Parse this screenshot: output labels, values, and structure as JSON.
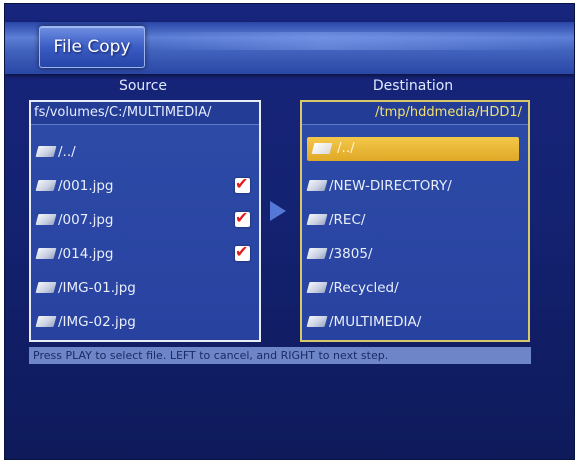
{
  "header": {
    "title": "File Copy"
  },
  "source": {
    "label": "Source",
    "path": "fs/volumes/C:/MULTIMEDIA/",
    "items": [
      {
        "name": "/../",
        "checked": false
      },
      {
        "name": "/001.jpg",
        "checked": true
      },
      {
        "name": "/007.jpg",
        "checked": true
      },
      {
        "name": "/014.jpg",
        "checked": true
      },
      {
        "name": "/IMG-01.jpg",
        "checked": false
      },
      {
        "name": "/IMG-02.jpg",
        "checked": false
      }
    ]
  },
  "destination": {
    "label": "Destination",
    "path": "/tmp/hddmedia/HDD1/",
    "items": [
      {
        "name": "/../",
        "selected": true
      },
      {
        "name": "/NEW-DIRECTORY/"
      },
      {
        "name": "/REC/"
      },
      {
        "name": "/3805/"
      },
      {
        "name": "/Recycled/"
      },
      {
        "name": "/MULTIMEDIA/"
      }
    ]
  },
  "status": "Press PLAY to select file. LEFT to cancel, and RIGHT to next step.",
  "icons": {
    "file": "file-icon",
    "check": "checkmark-icon",
    "arrow": "right-arrow-icon"
  },
  "colors": {
    "background": "#18257d",
    "highlight": "#e8b535",
    "checkmark": "#e11c1c"
  }
}
